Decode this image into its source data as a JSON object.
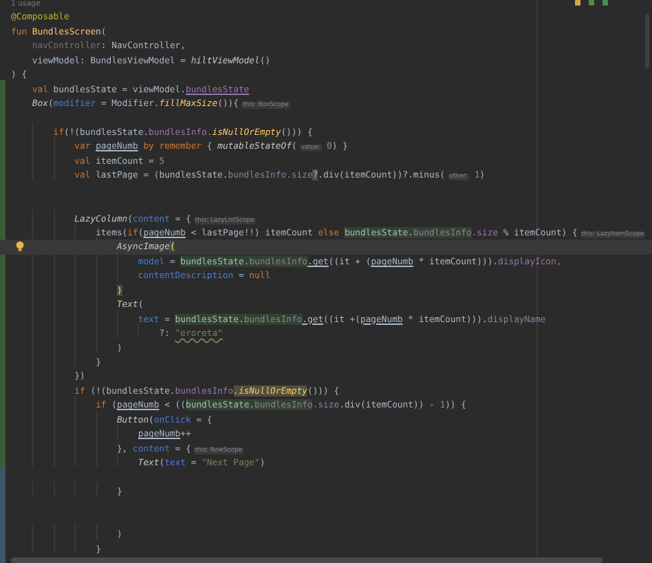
{
  "editor": {
    "lines": [
      {
        "current": false,
        "tokens": [
          {
            "t": "1 usage",
            "kind": "usage"
          }
        ]
      },
      {
        "current": false,
        "tokens": [
          {
            "t": "@Composable",
            "kind": "annotation"
          }
        ]
      },
      {
        "current": false,
        "tokens": [
          {
            "t": "fun ",
            "kind": "keyword"
          },
          {
            "t": "BundlesScreen",
            "kind": "fndecl"
          },
          {
            "t": "(",
            "kind": "plain"
          }
        ]
      },
      {
        "current": false,
        "tokens": [
          {
            "t": "    navController",
            "kind": "unused"
          },
          {
            "t": ": NavController,",
            "kind": "plain"
          }
        ]
      },
      {
        "current": false,
        "tokens": [
          {
            "t": "    viewModel: BundlesViewModel = ",
            "kind": "plain"
          },
          {
            "t": "hiltViewModel",
            "kind": "call"
          },
          {
            "t": "()",
            "kind": "plain"
          }
        ]
      },
      {
        "current": false,
        "tokens": [
          {
            "t": ") {",
            "kind": "plain"
          }
        ]
      },
      {
        "current": false,
        "tokens": [
          {
            "t": "    val ",
            "kind": "keyword"
          },
          {
            "t": "bundlesState = viewModel.",
            "kind": "plain"
          },
          {
            "t": "bundlesState",
            "kind": "prop-ul"
          }
        ]
      },
      {
        "current": false,
        "tokens": [
          {
            "t": "    Box",
            "kind": "call"
          },
          {
            "t": "(",
            "kind": "plain"
          },
          {
            "t": "modifier",
            "kind": "named"
          },
          {
            "t": " = Modifier.",
            "kind": "plain"
          },
          {
            "t": "fillMaxSize",
            "kind": "ext"
          },
          {
            "t": "()){",
            "kind": "plain"
          },
          {
            "t": "this: BoxScope",
            "kind": "hint"
          }
        ]
      },
      {
        "current": false
      },
      {
        "current": false,
        "tokens": [
          {
            "t": "        if",
            "kind": "keyword"
          },
          {
            "t": "(!(bundlesState.",
            "kind": "plain"
          },
          {
            "t": "bundlesInfo.",
            "kind": "prop"
          },
          {
            "t": "isNullOrEmpty",
            "kind": "ext"
          },
          {
            "t": "())) {",
            "kind": "plain"
          }
        ]
      },
      {
        "current": false,
        "tokens": [
          {
            "t": "            var ",
            "kind": "keyword"
          },
          {
            "t": "pageNumb",
            "kind": "var-ul"
          },
          {
            "t": " by remember",
            "kind": "keyword"
          },
          {
            "t": " { ",
            "kind": "plain"
          },
          {
            "t": "mutableStateOf",
            "kind": "call"
          },
          {
            "t": "(",
            "kind": "plain"
          },
          {
            "t": "value:",
            "kind": "hint"
          },
          {
            "t": " 0",
            "kind": "number"
          },
          {
            "t": ") }",
            "kind": "plain"
          }
        ]
      },
      {
        "current": false,
        "tokens": [
          {
            "t": "            val ",
            "kind": "keyword"
          },
          {
            "t": "itemCount = ",
            "kind": "plain"
          },
          {
            "t": "5",
            "kind": "number"
          }
        ]
      },
      {
        "current": false,
        "tokens": [
          {
            "t": "            val ",
            "kind": "keyword"
          },
          {
            "t": "lastPage = (bundlesState.",
            "kind": "plain"
          },
          {
            "t": "bundlesInfo.size",
            "kind": "prop"
          },
          {
            "t": "?",
            "kind": "warning"
          },
          {
            "t": ".div(itemCount))?.minus(",
            "kind": "plain"
          },
          {
            "t": "other:",
            "kind": "hint"
          },
          {
            "t": " 1",
            "kind": "number"
          },
          {
            "t": ")",
            "kind": "plain"
          }
        ]
      },
      {
        "current": false
      },
      {
        "current": false
      },
      {
        "current": false,
        "tokens": [
          {
            "t": "            LazyColumn",
            "kind": "call"
          },
          {
            "t": "(",
            "kind": "plain"
          },
          {
            "t": "content",
            "kind": "named"
          },
          {
            "t": " = {",
            "kind": "plain"
          },
          {
            "t": "this: LazyListScope",
            "kind": "hint"
          }
        ]
      },
      {
        "current": false,
        "tokens": [
          {
            "t": "                items(",
            "kind": "plain"
          },
          {
            "t": "if",
            "kind": "keyword"
          },
          {
            "t": "(",
            "kind": "plain"
          },
          {
            "t": "pageNumb",
            "kind": "var-ul"
          },
          {
            "t": " < lastPage!!) itemCount ",
            "kind": "plain"
          },
          {
            "t": "else ",
            "kind": "keyword"
          },
          {
            "t": "bundlesState.",
            "kind": "smart"
          },
          {
            "t": "bundlesInfo",
            "kind": "smart-prop"
          },
          {
            "t": ".size",
            "kind": "prop"
          },
          {
            "t": " % itemCount) {",
            "kind": "plain"
          },
          {
            "t": "this: LazyItemScope",
            "kind": "hint"
          }
        ]
      },
      {
        "current": true,
        "bulb": true,
        "tokens": [
          {
            "t": "                    AsyncImage",
            "kind": "call"
          },
          {
            "t": "(",
            "kind": "match"
          }
        ]
      },
      {
        "current": false,
        "tokens": [
          {
            "t": "                        model",
            "kind": "named"
          },
          {
            "t": " = ",
            "kind": "plain"
          },
          {
            "t": "bundlesState.",
            "kind": "smart"
          },
          {
            "t": "bundlesInfo",
            "kind": "smart-prop"
          },
          {
            "t": ".get",
            "kind": "fn-ul"
          },
          {
            "t": "((it + (",
            "kind": "plain"
          },
          {
            "t": "pageNumb",
            "kind": "var-ul"
          },
          {
            "t": " * itemCount))).",
            "kind": "plain"
          },
          {
            "t": "displayIcon",
            "kind": "prop"
          },
          {
            "t": ",",
            "kind": "keyword"
          }
        ]
      },
      {
        "current": false,
        "tokens": [
          {
            "t": "                        contentDescription",
            "kind": "named"
          },
          {
            "t": " = ",
            "kind": "plain"
          },
          {
            "t": "null",
            "kind": "keyword"
          }
        ]
      },
      {
        "current": false,
        "tokens": [
          {
            "t": "                    )",
            "kind": "match"
          }
        ]
      },
      {
        "current": false,
        "tokens": [
          {
            "t": "                    Text",
            "kind": "call"
          },
          {
            "t": "(",
            "kind": "plain"
          }
        ]
      },
      {
        "current": false,
        "tokens": [
          {
            "t": "                        text",
            "kind": "named"
          },
          {
            "t": " = ",
            "kind": "plain"
          },
          {
            "t": "bundlesState.",
            "kind": "smart"
          },
          {
            "t": "bundlesInfo",
            "kind": "smart-prop"
          },
          {
            "t": ".get",
            "kind": "fn-ul"
          },
          {
            "t": "((it +(",
            "kind": "plain"
          },
          {
            "t": "pageNumb",
            "kind": "var-ul"
          },
          {
            "t": " * itemCount))).",
            "kind": "plain"
          },
          {
            "t": "displayName",
            "kind": "prop"
          }
        ]
      },
      {
        "current": false,
        "tokens": [
          {
            "t": "                            ?: ",
            "kind": "plain"
          },
          {
            "t": "\"eroreta\"",
            "kind": "string-ul"
          }
        ]
      },
      {
        "current": false,
        "tokens": [
          {
            "t": "                    )",
            "kind": "plain"
          }
        ]
      },
      {
        "current": false,
        "tokens": [
          {
            "t": "                }",
            "kind": "plain"
          }
        ]
      },
      {
        "current": false,
        "tokens": [
          {
            "t": "            })",
            "kind": "plain"
          }
        ]
      },
      {
        "current": false,
        "tokens": [
          {
            "t": "            if ",
            "kind": "keyword"
          },
          {
            "t": "(!(bundlesState.",
            "kind": "plain"
          },
          {
            "t": "bundlesInfo",
            "kind": "prop"
          },
          {
            "t": ".isNullOrEmpty",
            "kind": "warning-ext"
          },
          {
            "t": "())) {",
            "kind": "plain"
          }
        ]
      },
      {
        "current": false,
        "tokens": [
          {
            "t": "                if ",
            "kind": "keyword"
          },
          {
            "t": "(",
            "kind": "plain"
          },
          {
            "t": "pageNumb",
            "kind": "var-ul"
          },
          {
            "t": " < ((",
            "kind": "plain"
          },
          {
            "t": "bundlesState.",
            "kind": "smart"
          },
          {
            "t": "bundlesInfo",
            "kind": "smart-prop"
          },
          {
            "t": ".size",
            "kind": "prop"
          },
          {
            "t": ".div(itemCount)) - ",
            "kind": "plain"
          },
          {
            "t": "1",
            "kind": "number"
          },
          {
            "t": ")) {",
            "kind": "plain"
          }
        ]
      },
      {
        "current": false,
        "tokens": [
          {
            "t": "                    Button",
            "kind": "call"
          },
          {
            "t": "(",
            "kind": "plain"
          },
          {
            "t": "onClick",
            "kind": "named"
          },
          {
            "t": " = {",
            "kind": "plain"
          }
        ]
      },
      {
        "current": false,
        "tokens": [
          {
            "t": "                        pageNumb",
            "kind": "var-ul"
          },
          {
            "t": "++",
            "kind": "plain"
          }
        ]
      },
      {
        "current": false,
        "tokens": [
          {
            "t": "                    }, ",
            "kind": "plain"
          },
          {
            "t": "content",
            "kind": "named"
          },
          {
            "t": " = {",
            "kind": "plain"
          },
          {
            "t": "this: RowScope",
            "kind": "hint"
          }
        ]
      },
      {
        "current": false,
        "tokens": [
          {
            "t": "                        Text",
            "kind": "call"
          },
          {
            "t": "(",
            "kind": "plain"
          },
          {
            "t": "text",
            "kind": "named"
          },
          {
            "t": " = ",
            "kind": "plain"
          },
          {
            "t": "\"Next Page\"",
            "kind": "string"
          },
          {
            "t": ")",
            "kind": "plain"
          }
        ]
      },
      {
        "current": false
      },
      {
        "current": false,
        "tokens": [
          {
            "t": "                    }",
            "kind": "plain"
          }
        ]
      },
      {
        "current": false
      },
      {
        "current": false
      },
      {
        "current": false,
        "tokens": [
          {
            "t": "                    )",
            "kind": "plain"
          }
        ]
      },
      {
        "current": false,
        "tokens": [
          {
            "t": "                }",
            "kind": "plain"
          }
        ]
      }
    ]
  }
}
